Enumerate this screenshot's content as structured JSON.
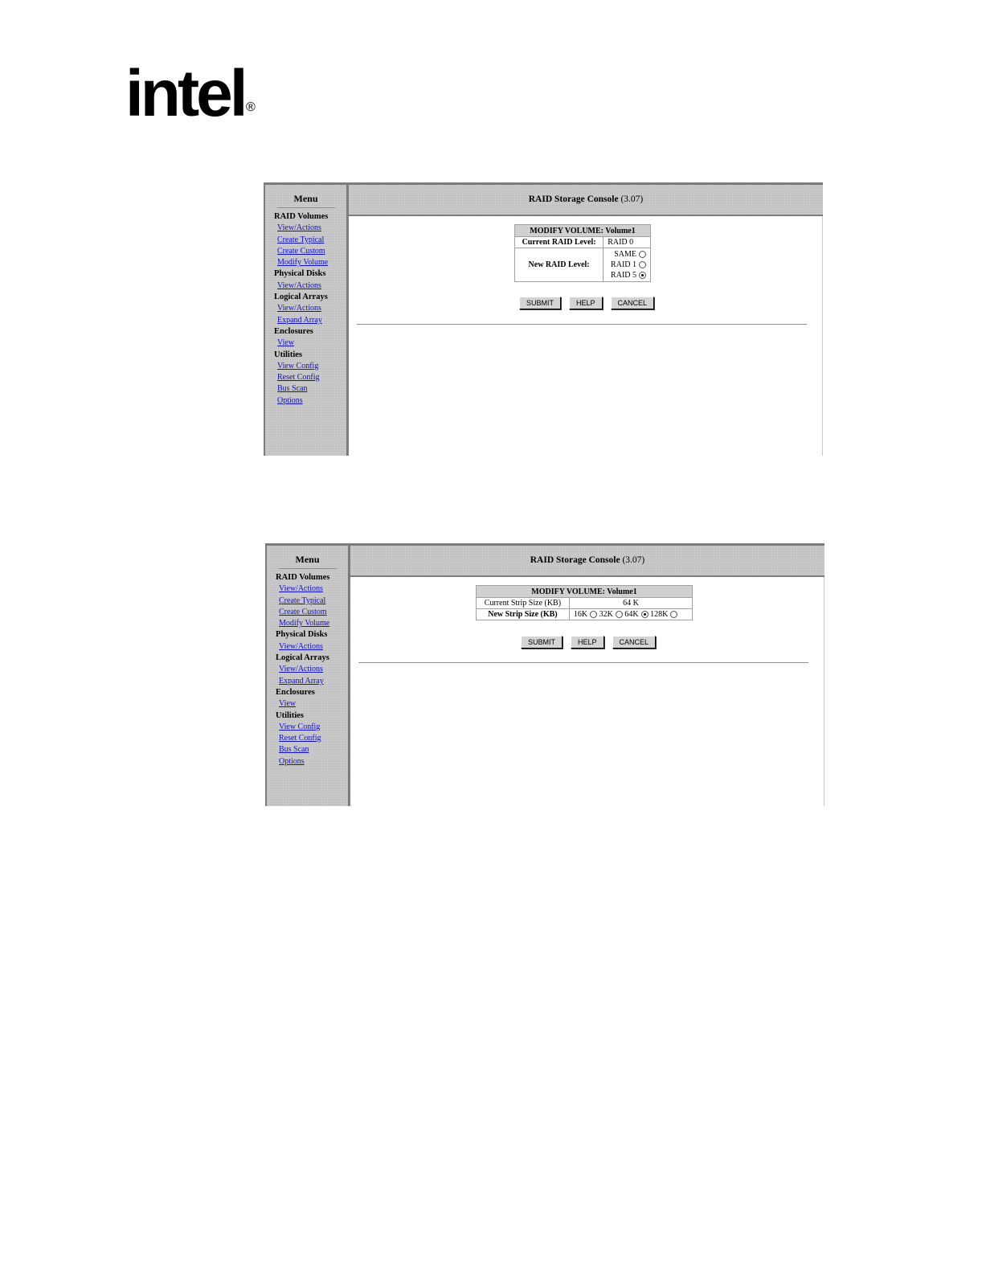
{
  "logo": {
    "text": "intel",
    "registered": "®"
  },
  "menu": {
    "title": "Menu",
    "sections": [
      {
        "label": "RAID Volumes",
        "links": [
          "View/Actions",
          "Create Typical",
          "Create Custom",
          "Modify Volume"
        ]
      },
      {
        "label": "Physical Disks",
        "links": [
          "View/Actions"
        ]
      },
      {
        "label": "Logical Arrays",
        "links": [
          "View/Actions",
          "Expand Array"
        ]
      },
      {
        "label": "Enclosures",
        "links": [
          "View"
        ]
      },
      {
        "label": "Utilities",
        "links": [
          "View Config",
          "Reset Config",
          "Bus Scan",
          "Options"
        ]
      }
    ]
  },
  "header": {
    "title": "RAID Storage Console",
    "version": "(3.07)"
  },
  "buttons": {
    "submit": "SUBMIT",
    "help": "HELP",
    "cancel": "CANCEL"
  },
  "screen1": {
    "caption": "MODIFY VOLUME: Volume1",
    "current_label": "Current RAID Level:",
    "current_value": "RAID 0",
    "new_label": "New RAID Level:",
    "options": [
      {
        "label": "SAME",
        "selected": false
      },
      {
        "label": "RAID 1",
        "selected": false
      },
      {
        "label": "RAID 5",
        "selected": true
      }
    ]
  },
  "screen2": {
    "caption": "MODIFY VOLUME: Volume1",
    "current_label": "Current Strip Size (KB)",
    "current_value": "64 K",
    "new_label": "New Strip Size (KB)",
    "options": [
      {
        "label": "16K",
        "selected": false
      },
      {
        "label": "32K",
        "selected": false
      },
      {
        "label": "64K",
        "selected": true
      },
      {
        "label": "128K",
        "selected": false
      }
    ]
  }
}
